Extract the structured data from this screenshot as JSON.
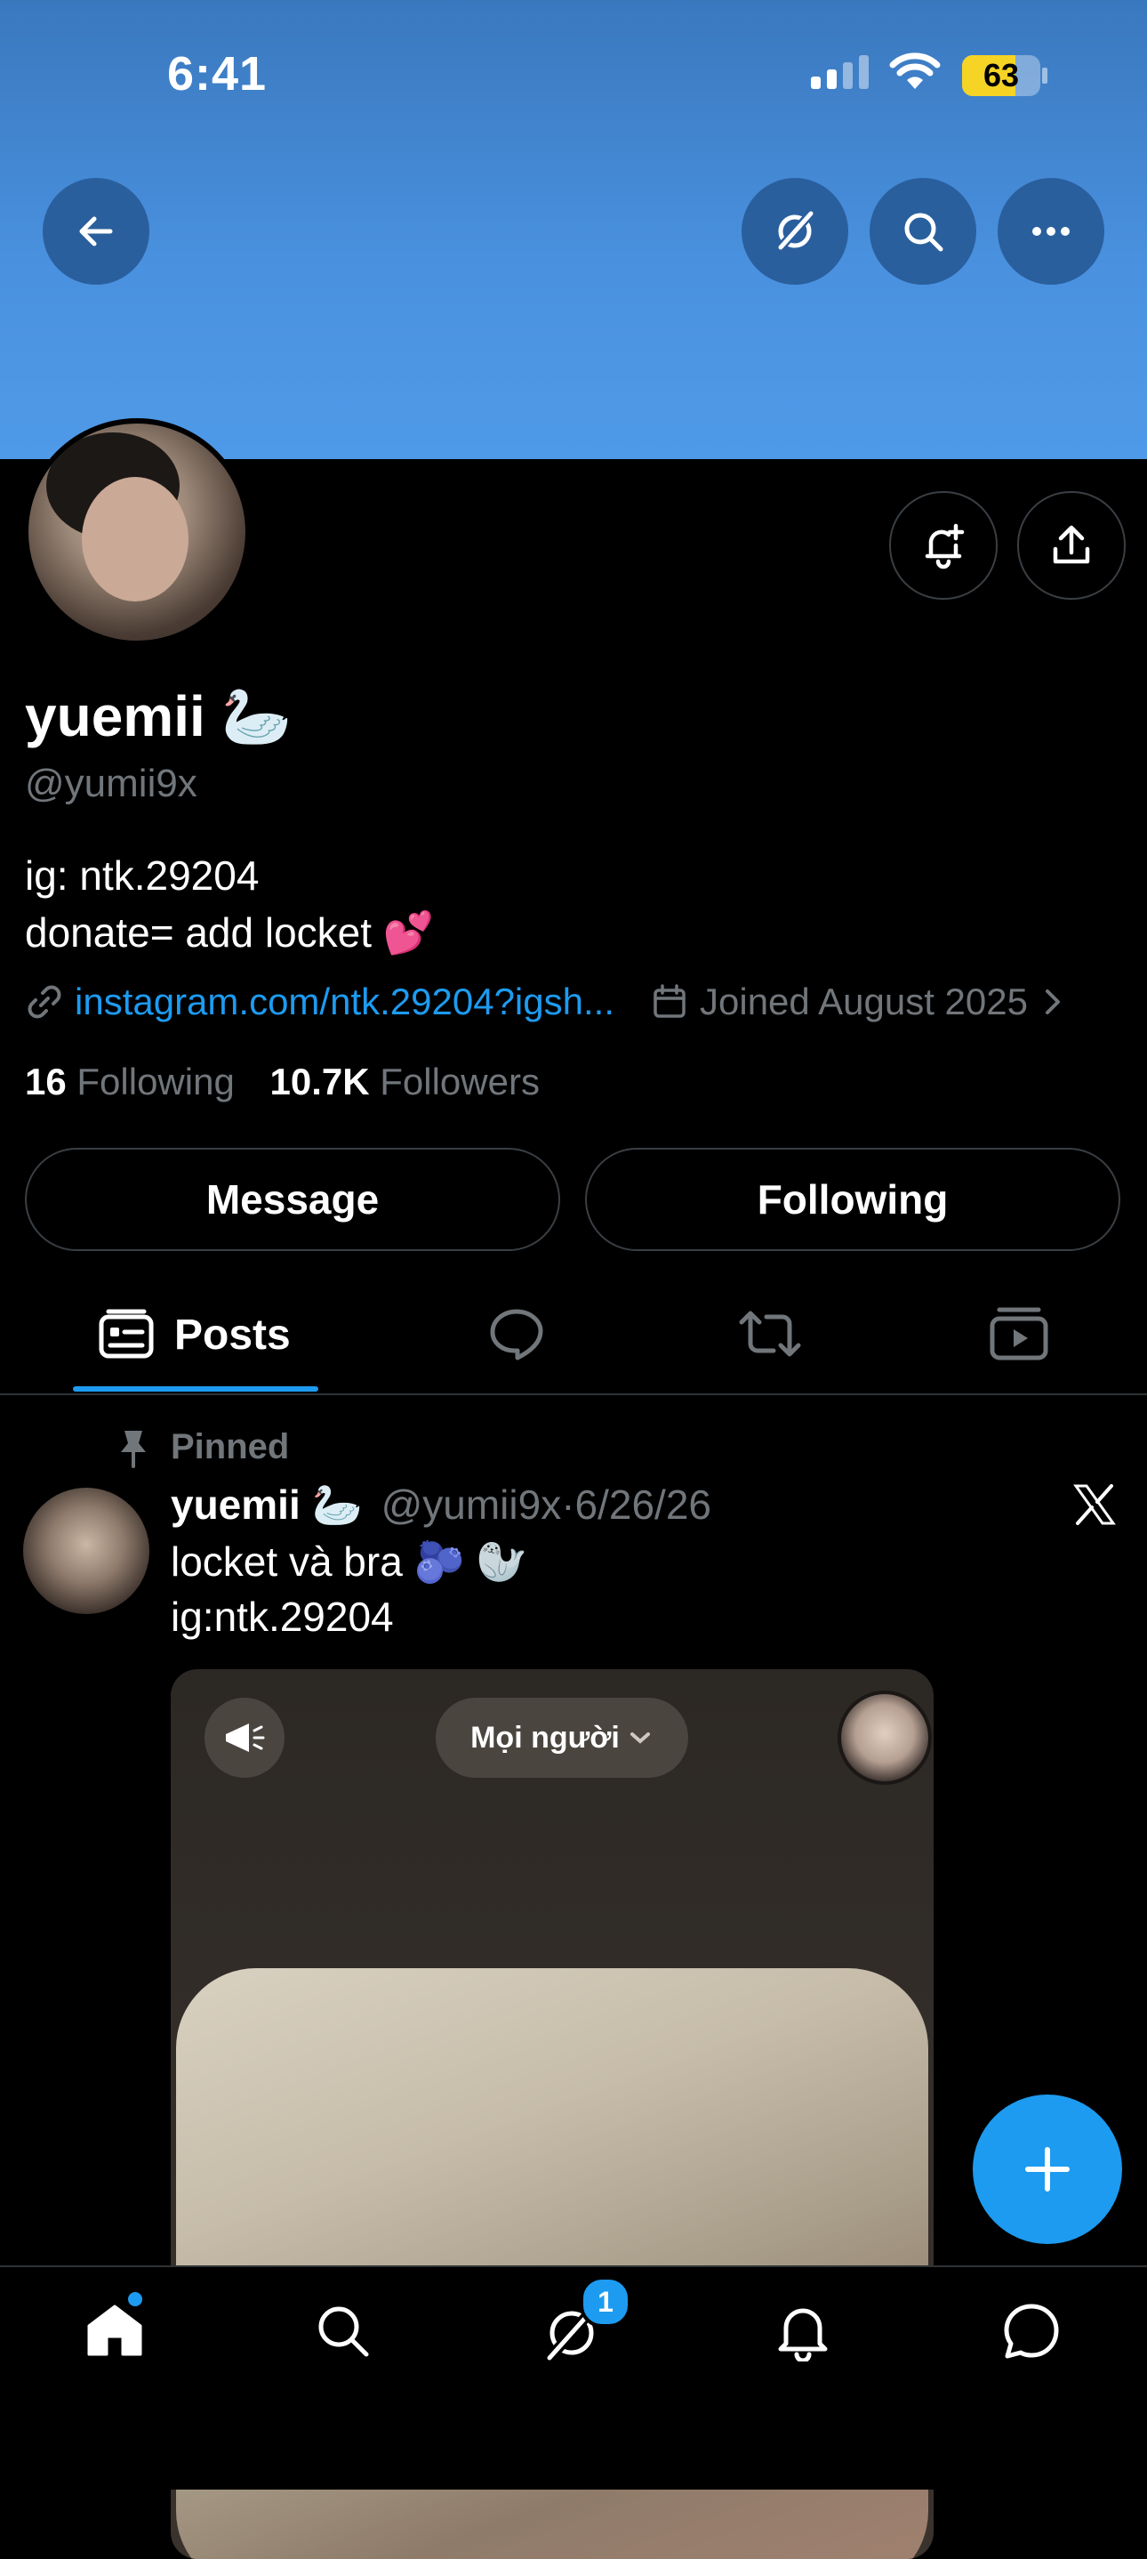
{
  "status_bar": {
    "time": "6:41",
    "battery": "63"
  },
  "profile": {
    "name": "yuemii",
    "name_emoji": "🦢",
    "handle": "@yumii9x",
    "bio_line1": "ig: ntk.29204",
    "bio_line2": "donate= add locket",
    "bio_emoji": "💕",
    "link": "instagram.com/ntk.29204?igsh...",
    "joined": "Joined August 2025",
    "following_count": "16",
    "following_label": "Following",
    "followers_count": "10.7K",
    "followers_label": "Followers"
  },
  "actions": {
    "message": "Message",
    "following": "Following"
  },
  "tabs": {
    "posts": "Posts"
  },
  "post": {
    "pinned_label": "Pinned",
    "author": "yuemii",
    "author_emoji": "🦢",
    "handle": "@yumii9x",
    "separator": "·",
    "date": "6/26/26",
    "line1": "locket và bra",
    "line1_emoji": "🫐 🦭",
    "line2": "ig:ntk.29204",
    "media_dropdown": "Mọi người"
  },
  "nav": {
    "badge": "1"
  },
  "colors": {
    "accent": "#1d9bf0",
    "banner": "#4a92e0",
    "muted": "#71767b"
  }
}
